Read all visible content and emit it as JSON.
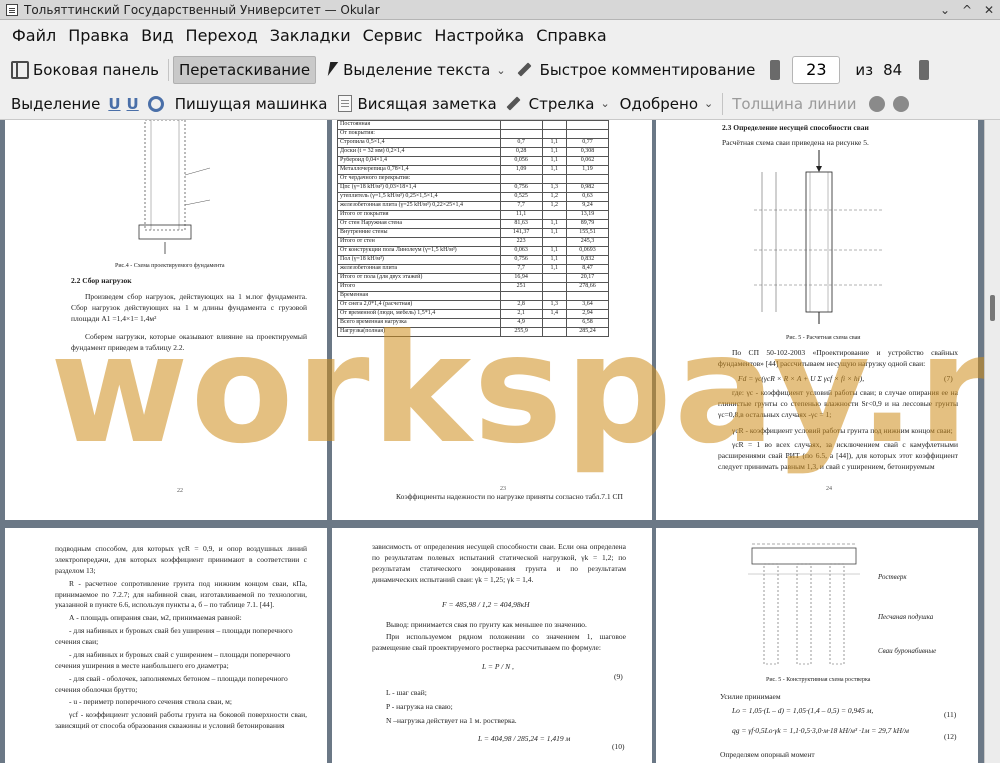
{
  "window": {
    "title": "Тольяттинский Государственный Университет — Okular",
    "buttons": [
      "⌄",
      "^",
      "✕"
    ]
  },
  "menu": [
    "Файл",
    "Правка",
    "Вид",
    "Переход",
    "Закладки",
    "Сервис",
    "Настройка",
    "Справка"
  ],
  "toolbar": {
    "sidebar": "Боковая панель",
    "drag": "Перетаскивание",
    "text_select": "Выделение текста",
    "quick_comment": "Быстрое комментирование",
    "page_current": "23",
    "page_of": "из",
    "page_total": "84"
  },
  "annot_toolbar": {
    "highlight": "Выделение",
    "typewriter": "Пишущая машинка",
    "note": "Висящая заметка",
    "arrow": "Стрелка",
    "approved": "Одобрено",
    "line_width": "Толщина линии"
  },
  "watermark": "workspay.ru",
  "pages": {
    "p22": {
      "number": "22",
      "fig_caption": "Рис.4 - Схема проектируемого фундамента",
      "heading": "2.2 Сбор нагрузок",
      "para1": "Произведем сбор нагрузок, действующих на 1 м.пог фундамента. Сбор нагрузок действующих на 1 м длины фундамента с грузовой площади А1 =1,4×1= 1,4м²",
      "para2": "Соберем нагрузки, которые оказывают влияние на проектируемый фундамент приведем в таблицу 2.2."
    },
    "p23": {
      "number": "23",
      "rows": [
        [
          "Постоянная",
          "",
          "",
          ""
        ],
        [
          "От покрытия:",
          "",
          "",
          ""
        ],
        [
          "Стропила 0,5×1,4",
          "0,7",
          "1,1",
          "0,77"
        ],
        [
          "Доски (t = 32 мм) 0,2×1,4",
          "0,28",
          "1,1",
          "0,308"
        ],
        [
          "Рубероид 0,04×1,4",
          "0,056",
          "1,1",
          "0,062"
        ],
        [
          "Металлочерепица 0,78×1,4",
          "1,09",
          "1,1",
          "1,19"
        ],
        [
          "От чердачного перекрытия:",
          "",
          "",
          ""
        ],
        [
          "Цпс (γ=18 kH/м³) 0,03×18×1,4",
          "0,756",
          "1,3",
          "0,982"
        ],
        [
          "утеплитель (γ=1,5 kH/м³) 0,25×1,5×1,4",
          "0,525",
          "1,2",
          "0,63"
        ],
        [
          "железобетонная плита (γ=25 kH/м³) 0,22×25×1,4",
          "7,7",
          "1,2",
          "9,24"
        ],
        [
          "Итого от покрытия",
          "11,1",
          "",
          "13,19"
        ],
        [
          "От стен Наружная стена",
          "81,63",
          "1,1",
          "89,79"
        ],
        [
          "Внутренние стены",
          "141,37",
          "1,1",
          "155,51"
        ],
        [
          "Итого от стен",
          "223",
          "",
          "245,3"
        ],
        [
          "От конструкции пола Линолеум (γ=1,5 kH/м³)",
          "0,063",
          "1,1",
          "0,0693"
        ],
        [
          "Пол (γ=18 kH/м³)",
          "0,756",
          "1,1",
          "0,832"
        ],
        [
          "железобетонная плита",
          "7,7",
          "1,1",
          "8,47"
        ],
        [
          "Итого от пола (для двух этажей)",
          "16,94",
          "",
          "20,17"
        ],
        [
          "Итого",
          "251",
          "",
          "278,66"
        ],
        [
          "Временная",
          "",
          "",
          ""
        ],
        [
          "От снега 2,0*1,4 (расчетная)",
          "2,8",
          "1,3",
          "3,64"
        ],
        [
          "От временной (люди, мебель) 1,5*1,4",
          "2,1",
          "1,4",
          "2,94"
        ],
        [
          "Всего временная нагрузка",
          "4,9",
          "",
          "6,58"
        ],
        [
          "Нагрузка(полная)",
          "255,9",
          "",
          "285,24"
        ]
      ],
      "after": "Коэффициенты надежности по нагрузке приняты согласно табл.7.1 СП"
    },
    "p24": {
      "number": "24",
      "heading": "2.3 Определение несущей способности сваи",
      "intro": "Расчётная схема сваи приведена на рисунке 5.",
      "fig_caption": "Рис. 5 - Расчетная схема сваи",
      "para1": "По СП 50-102-2003 «Проектирование и устройство свайных фундаментов» [44] рассчитываем несущую нагрузку одной сваи:",
      "formula": "Fd = γc(γcR × R × A + U Σ γcf × fi × hi),",
      "formula_no": "(7)",
      "para2": "где: γc - коэффициент условий работы сваи; в случае опирания ее на глинистые грунты со степенью влажности Sr<0,9 и на лессовые грунты γc=0,8,в остальных случаях -γc = 1;",
      "para3": "γcR - коэффициент условий работы грунта под нижним концом сваи;",
      "para4": "γcR = 1 во всех случаях, за исключением свай с камуфлетными расширениями свай РИТ (по 6.5, а [44]), для которых этот коэффициент следует принимать равным 1,3, и свай с уширением, бетонируемым"
    },
    "p25": {
      "lines": [
        "подводным способом, для которых γcR = 0,9, и опор воздушных линий электропередачи, для которых коэффициент принимают в соответствии с разделом 13;",
        "R - расчетное сопротивление грунта под нижним концом сваи, кПа, принимаемое по 7.2.7; для набивной сваи, изготавливаемой по технологии, указанной в пункте 6.6, используя пункты а, б – по таблице 7.1. [44].",
        "А - площадь опирания сваи, м2, принимаемая равной:",
        "- для набивных и буровых свай без уширения – площади поперечного сечения сваи;",
        "- для набивных и буровых свай с уширением – площади поперечного сечения уширения в месте наибольшего его диаметра;",
        "- для свай - оболочек, заполняемых бетоном – площади поперечного сечения оболочки брутто;",
        "- u - периметр поперечного сечения ствола сваи, м;",
        "γcf - коэффициент условий работы грунта на боковой поверхности сваи, зависящий от способа образования скважины и условий бетонирования"
      ]
    },
    "p26": {
      "para1": "зависимость от определения несущей способности сваи. Если она определена по результатам полевых испытаний статической нагрузкой, γk = 1,2; по результатам статического зондирования грунта и по результатам динамических испытаний сваи: γk = 1,25; γk = 1,4.",
      "formula1": "F = 485,98 / 1,2 = 404,98кН",
      "para2": "Вывод: принимается свая по грунту как меньшее по значению.",
      "para3": "При используемом рядном положении со значением 1, шаговое размещение свай проектируемого ростверка рассчитываем по формуле:",
      "formula2": "L = P / N ,",
      "formula2_no": "(9)",
      "defs": [
        "L - шаг свай;",
        "P - нагрузка на сваю;",
        "N –нагрузка действует на 1 м. ростверка."
      ],
      "formula3": "L = 404,98 / 285,24 = 1,419 м",
      "formula3_no": "(10)"
    },
    "p27": {
      "labels": [
        "Ростверк",
        "Песчаная подушка",
        "Сваи буронабивные"
      ],
      "fig_caption": "Рис. 5 - Конструктивная схема ростверка",
      "line1": "Усилие принимаем",
      "formula1": "Lo = 1,05·(L – d) = 1,05·(1,4 – 0,5) = 0,945 м,",
      "formula1_no": "(11)",
      "formula2": "qg = γf·0,5Lo·γk = 1,1·0,5·3,0·м·18 kH/м³ ·1м = 29,7 kH/м",
      "formula2_no": "(12)",
      "line2": "Определяем опорный момент"
    }
  }
}
